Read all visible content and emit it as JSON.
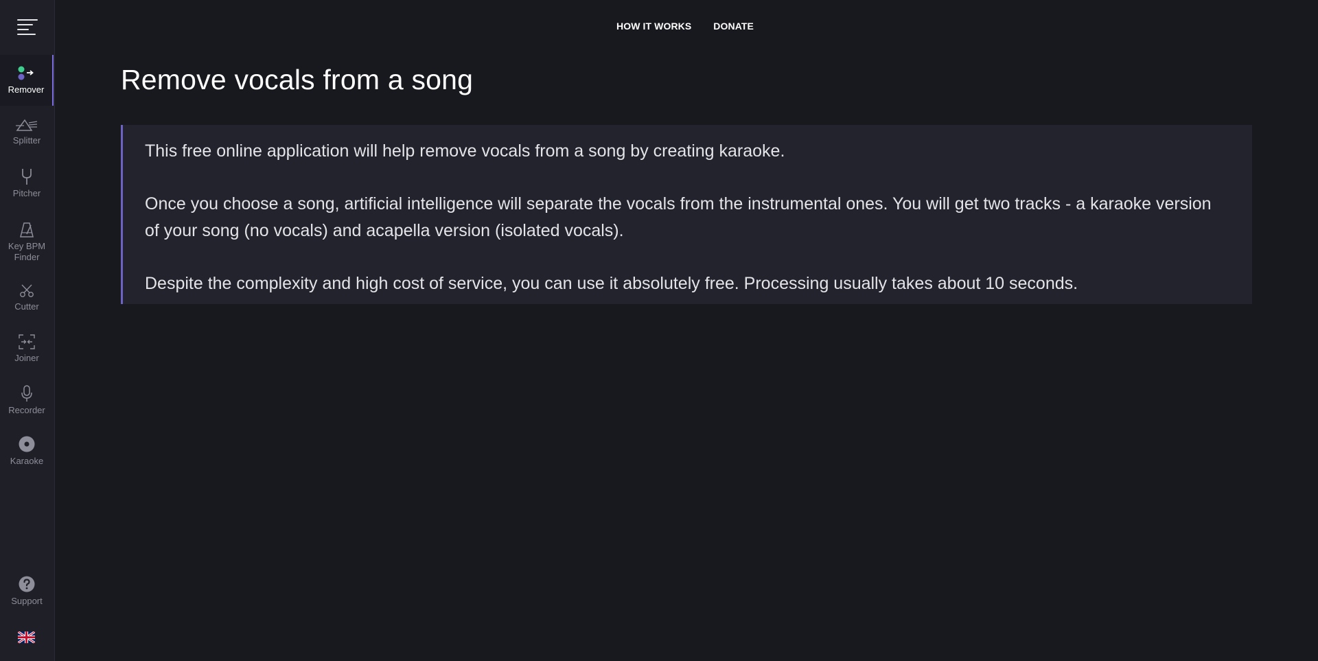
{
  "sidebar": {
    "items": [
      {
        "label": "Remover",
        "icon": "remover-icon",
        "active": true
      },
      {
        "label": "Splitter",
        "icon": "splitter-icon",
        "active": false
      },
      {
        "label": "Pitcher",
        "icon": "tuning-fork-icon",
        "active": false
      },
      {
        "label": "Key BPM Finder",
        "icon": "metronome-icon",
        "active": false
      },
      {
        "label": "Cutter",
        "icon": "scissors-icon",
        "active": false
      },
      {
        "label": "Joiner",
        "icon": "joiner-icon",
        "active": false
      },
      {
        "label": "Recorder",
        "icon": "microphone-icon",
        "active": false
      },
      {
        "label": "Karaoke",
        "icon": "disc-icon",
        "active": false
      }
    ],
    "support_label": "Support",
    "language_icon": "uk-flag-icon"
  },
  "topnav": {
    "how_it_works": "HOW IT WORKS",
    "donate": "DONATE"
  },
  "main": {
    "title": "Remove vocals from a song",
    "paragraphs": [
      "This free online application will help remove vocals from a song by creating karaoke.",
      "Once you choose a song, artificial intelligence will separate the vocals from the instrumental ones. You will get two tracks - a karaoke version of your song (no vocals) and acapella version (isolated vocals).",
      "Despite the complexity and high cost of service, you can use it absolutely free. Processing usually takes about 10 seconds."
    ]
  },
  "colors": {
    "background": "#18191f",
    "sidebar": "#1e1f27",
    "accent": "#7b6fe0",
    "green_dot": "#3ecf8e",
    "purple_dot": "#6c63c4"
  }
}
